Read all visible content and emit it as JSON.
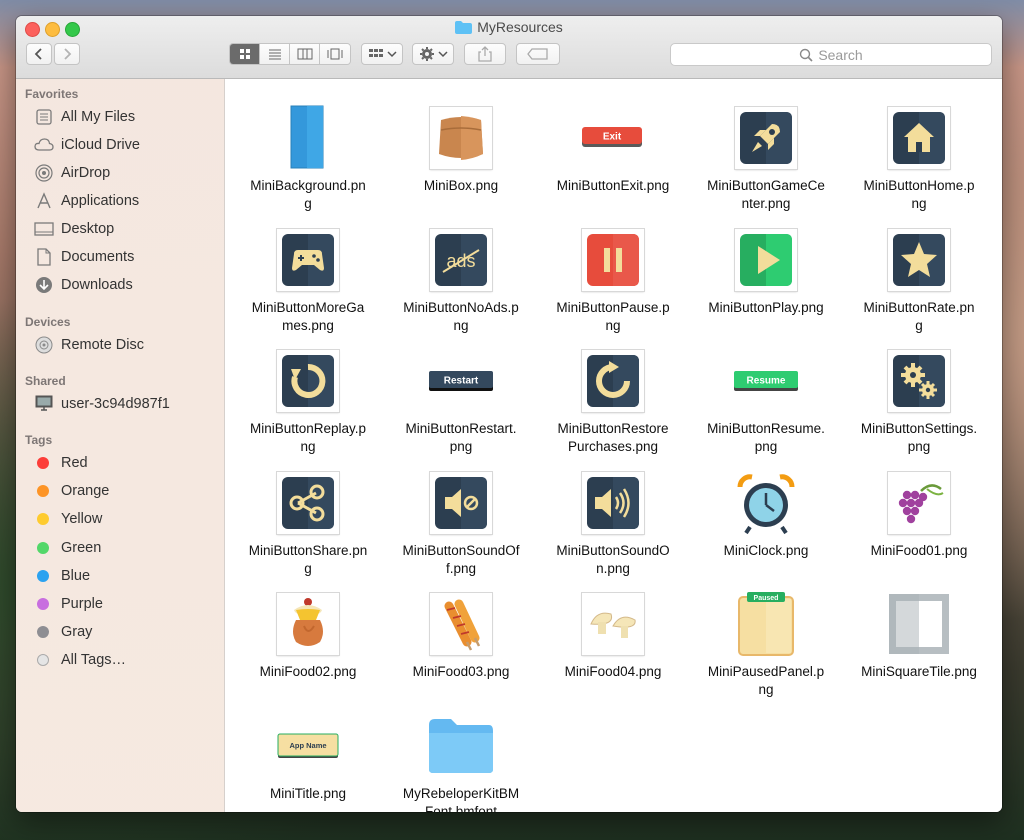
{
  "window": {
    "title": "MyResources"
  },
  "toolbar": {
    "search_placeholder": "Search"
  },
  "sidebar": {
    "favorites_header": "Favorites",
    "favorites": [
      "All My Files",
      "iCloud Drive",
      "AirDrop",
      "Applications",
      "Desktop",
      "Documents",
      "Downloads"
    ],
    "devices_header": "Devices",
    "devices": [
      "Remote Disc"
    ],
    "shared_header": "Shared",
    "shared": [
      "user-3c94d987f1"
    ],
    "tags_header": "Tags",
    "tags": [
      {
        "label": "Red",
        "color": "#fc3d39"
      },
      {
        "label": "Orange",
        "color": "#fd9426"
      },
      {
        "label": "Yellow",
        "color": "#fecb2f"
      },
      {
        "label": "Green",
        "color": "#53d769"
      },
      {
        "label": "Blue",
        "color": "#2ba2f0"
      },
      {
        "label": "Purple",
        "color": "#c86edf"
      },
      {
        "label": "Gray",
        "color": "#8e8e93"
      },
      {
        "label": "All Tags…",
        "color": "#cccccc"
      }
    ]
  },
  "files": [
    {
      "line1": "MiniBackground.pn",
      "line2": "g",
      "icon": "blue-rectangle-icon"
    },
    {
      "line1": "MiniBox.png",
      "line2": "",
      "icon": "box-icon"
    },
    {
      "line1": "MiniButtonExit.png",
      "line2": "",
      "icon": "exit-button-icon",
      "text": "Exit"
    },
    {
      "line1": "MiniButtonGameCe",
      "line2": "nter.png",
      "icon": "rocket-icon"
    },
    {
      "line1": "MiniButtonHome.p",
      "line2": "ng",
      "icon": "home-icon"
    },
    {
      "line1": "MiniButtonMoreGa",
      "line2": "mes.png",
      "icon": "gamepad-icon"
    },
    {
      "line1": "MiniButtonNoAds.p",
      "line2": "ng",
      "icon": "no-ads-icon",
      "text": "ads"
    },
    {
      "line1": "MiniButtonPause.p",
      "line2": "ng",
      "icon": "pause-icon"
    },
    {
      "line1": "MiniButtonPlay.png",
      "line2": "",
      "icon": "play-icon"
    },
    {
      "line1": "MiniButtonRate.pn",
      "line2": "g",
      "icon": "star-icon"
    },
    {
      "line1": "MiniButtonReplay.p",
      "line2": "ng",
      "icon": "replay-icon"
    },
    {
      "line1": "MiniButtonRestart.",
      "line2": "png",
      "icon": "restart-button-icon",
      "text": "Restart"
    },
    {
      "line1": "MiniButtonRestore",
      "line2": "Purchases.png",
      "icon": "restore-icon"
    },
    {
      "line1": "MiniButtonResume.",
      "line2": "png",
      "icon": "resume-button-icon",
      "text": "Resume"
    },
    {
      "line1": "MiniButtonSettings.",
      "line2": "png",
      "icon": "gears-icon"
    },
    {
      "line1": "MiniButtonShare.pn",
      "line2": "g",
      "icon": "share-icon"
    },
    {
      "line1": "MiniButtonSoundOf",
      "line2": "f.png",
      "icon": "sound-off-icon"
    },
    {
      "line1": "MiniButtonSoundO",
      "line2": "n.png",
      "icon": "sound-on-icon"
    },
    {
      "line1": "MiniClock.png",
      "line2": "",
      "icon": "alarm-clock-icon"
    },
    {
      "line1": "MiniFood01.png",
      "line2": "",
      "icon": "grapes-icon"
    },
    {
      "line1": "MiniFood02.png",
      "line2": "",
      "icon": "pudding-icon"
    },
    {
      "line1": "MiniFood03.png",
      "line2": "",
      "icon": "corndog-icon"
    },
    {
      "line1": "MiniFood04.png",
      "line2": "",
      "icon": "mushroom-icon"
    },
    {
      "line1": "MiniPausedPanel.p",
      "line2": "ng",
      "icon": "paused-panel-icon",
      "text": "Paused"
    },
    {
      "line1": "MiniSquareTile.png",
      "line2": "",
      "icon": "square-tile-icon"
    },
    {
      "line1": "MiniTitle.png",
      "line2": "",
      "icon": "title-banner-icon",
      "text": "App Name"
    },
    {
      "line1": "MyRebeloperKitBM",
      "line2": "Font.bmfont",
      "icon": "folder-icon"
    }
  ]
}
